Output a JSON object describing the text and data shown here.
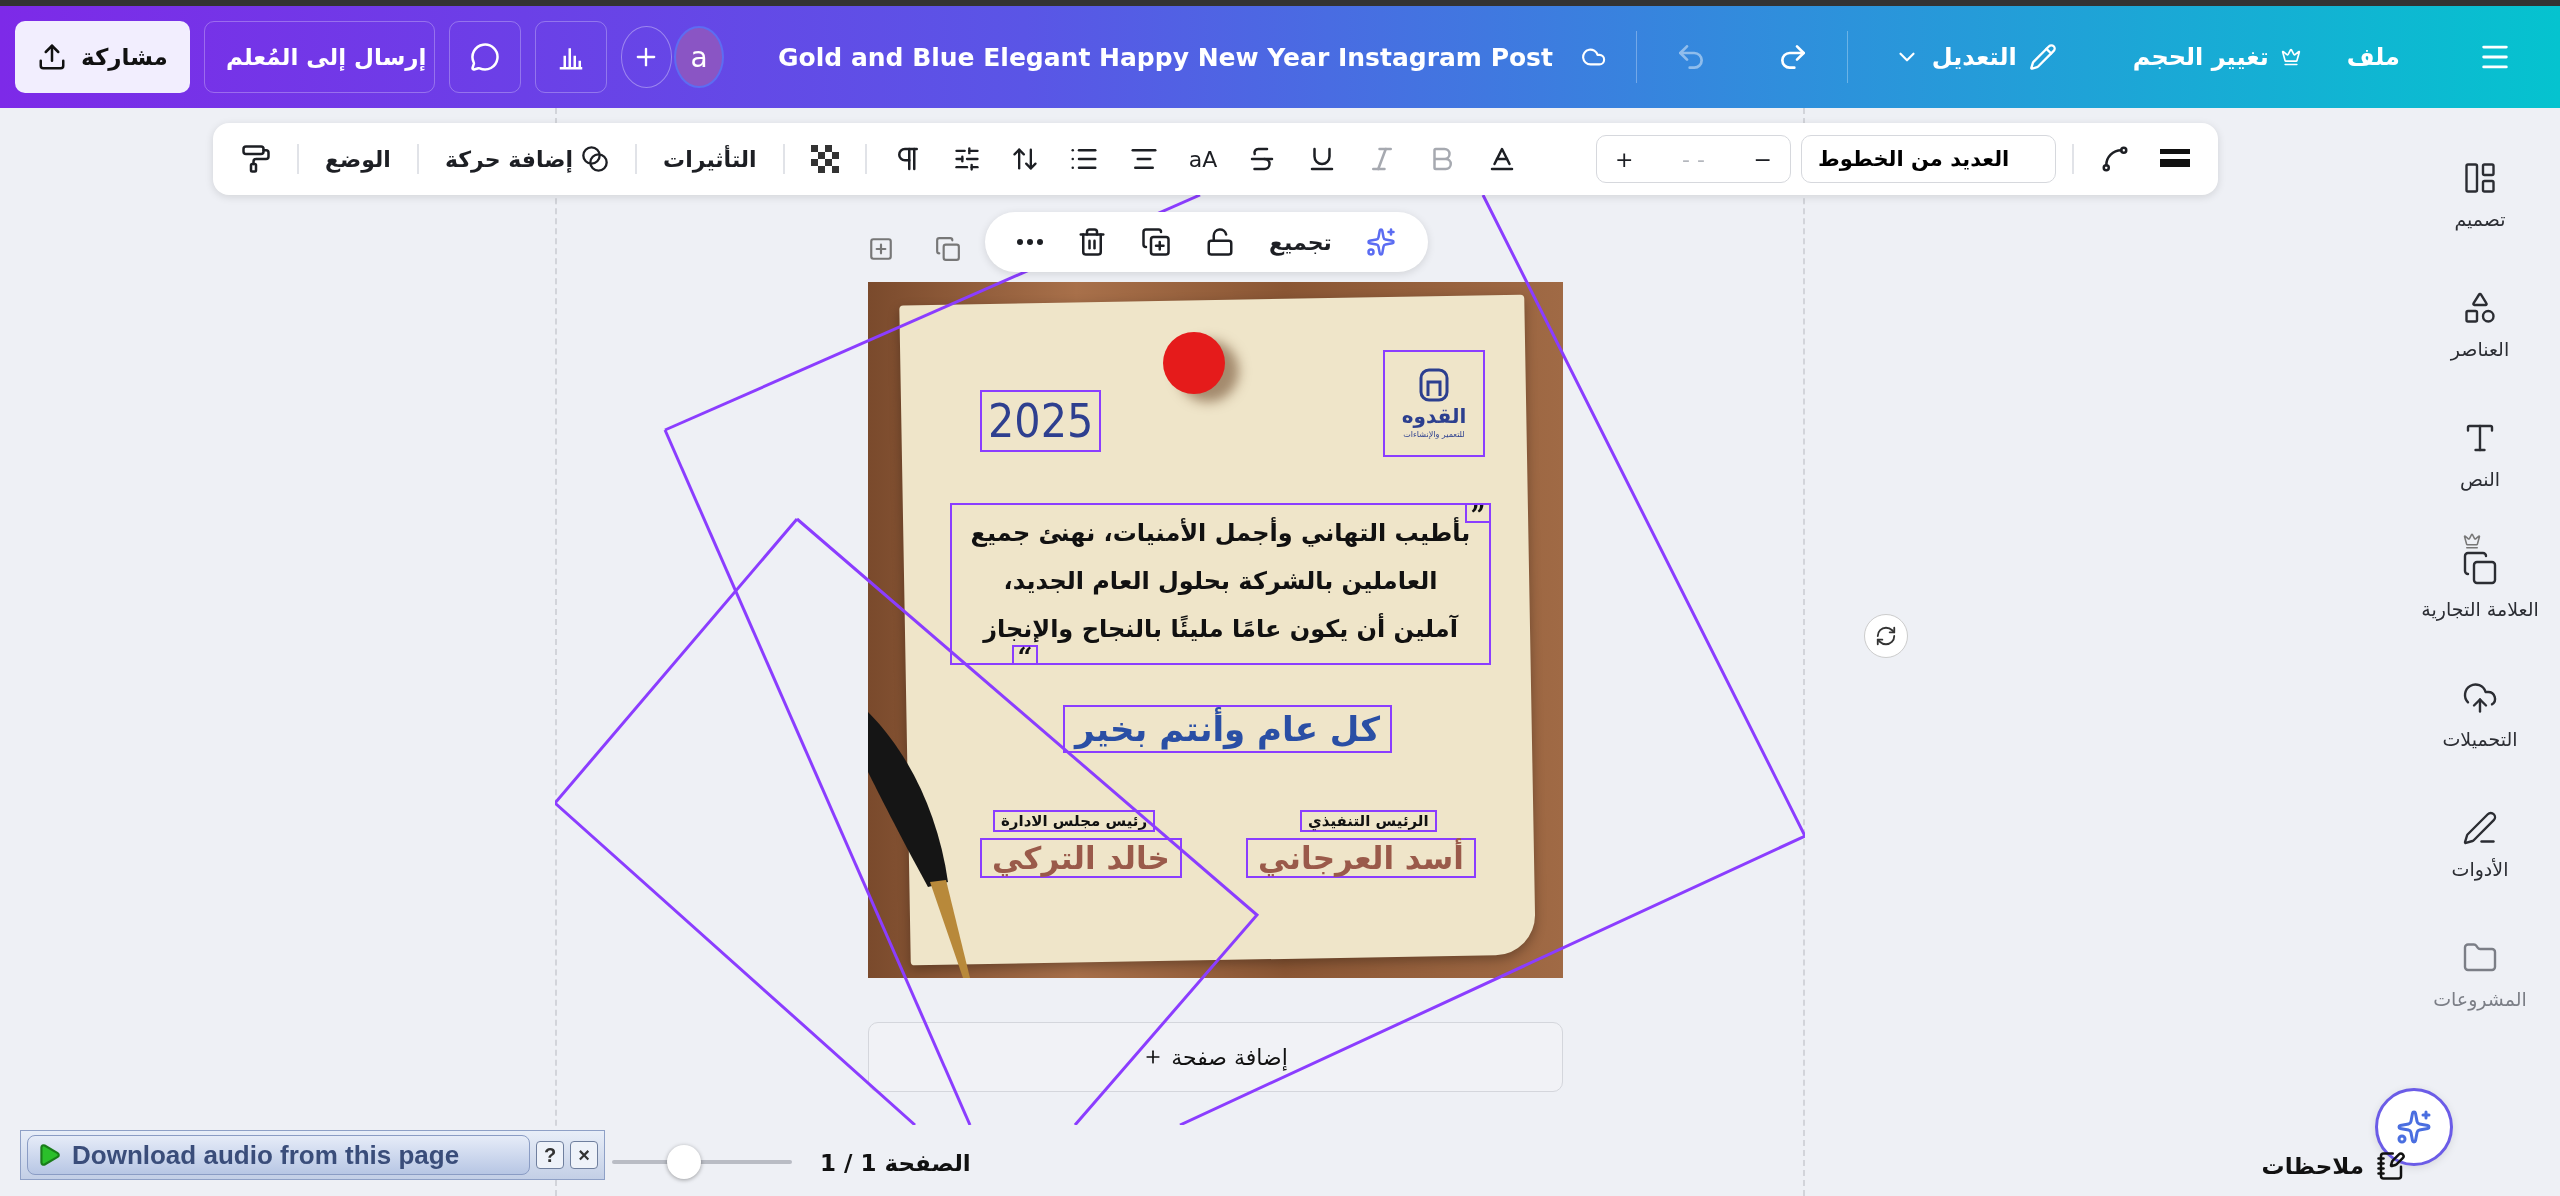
{
  "top_bar": {
    "file_menu": "ملف",
    "resize": {
      "label": "تغيير الحجم",
      "premium": true
    },
    "edit_mode": "التعديل",
    "undo": {
      "disabled": true
    },
    "redo": {
      "disabled": false
    },
    "title": "Gold and Blue Elegant Happy New Year Instagram Post",
    "avatar": "a",
    "send_button": "إرسال إلى المُعلم",
    "share_button": "مشاركة"
  },
  "toolbar": {
    "font": "العديد من الخطوط",
    "decrease": "−",
    "font_size": "- -",
    "increase": "+",
    "case_toggle": "aA",
    "position": "الوضع",
    "animate": "إضافة حركة",
    "effects": "التأثيرات",
    "format": [
      {
        "kind": "color",
        "disabled": false
      },
      {
        "kind": "bold",
        "disabled": true
      },
      {
        "kind": "italic",
        "disabled": true
      },
      {
        "kind": "underline",
        "disabled": false
      },
      {
        "kind": "strike",
        "disabled": false
      }
    ]
  },
  "selection_menu": {
    "group": "تجميع"
  },
  "design": {
    "year": "2025",
    "logo_name": "القدوه",
    "logo_tagline": "للتعمير والإنشاءات",
    "quote_open": "”",
    "quote_close": "“",
    "message": "بأطيب التهاني وأجمل الأمنيات، نهنئ جميع العاملين بالشركة بحلول العام الجديد، آملين أن يكون عامًا مليئًا بالنجاح والإنجاز",
    "greeting": "كل عام وأنتم بخير",
    "signatures": [
      {
        "title": "الرئيس التنفيذي",
        "name": "أسد العرجاني"
      },
      {
        "title": "رئيس مجلس الادارة",
        "name": "خالد التركي"
      }
    ]
  },
  "add_page": "إضافة صفحة",
  "sidebar": {
    "items": [
      {
        "kind": "design",
        "label": "تصميم",
        "premium": false,
        "disabled": false
      },
      {
        "kind": "elements",
        "label": "العناصر",
        "premium": false,
        "disabled": false
      },
      {
        "kind": "text",
        "label": "النص",
        "premium": false,
        "disabled": false
      },
      {
        "kind": "brand",
        "label": "العلامة التجارية",
        "premium": true,
        "disabled": false
      },
      {
        "kind": "uploads",
        "label": "التحميلات",
        "premium": false,
        "disabled": false
      },
      {
        "kind": "tools",
        "label": "الأدوات",
        "premium": false,
        "disabled": false
      },
      {
        "kind": "projects",
        "label": "المشروعات",
        "premium": false,
        "disabled": true
      }
    ]
  },
  "footer": {
    "notes": "ملاحظات",
    "page": "الصفحة 1 / 1",
    "zoom": {
      "level": 0.4
    }
  },
  "extension_bar": {
    "label": "Download audio from this page",
    "help": "?",
    "close": "×"
  }
}
